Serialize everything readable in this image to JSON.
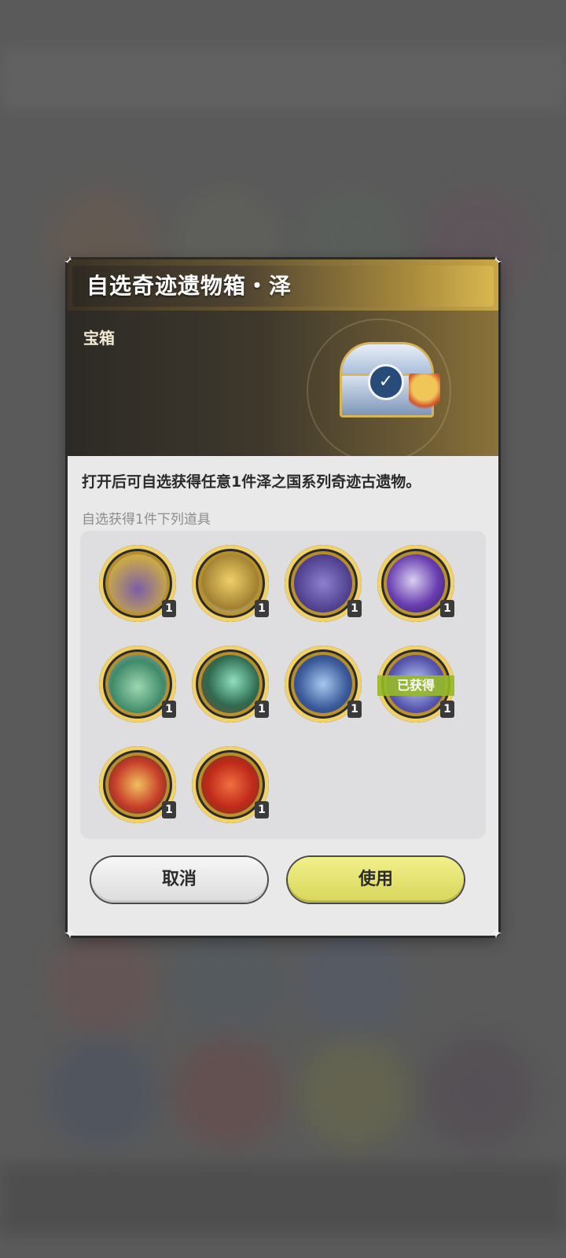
{
  "dialog": {
    "title": "自选奇迹遗物箱・泽",
    "category": "宝箱",
    "description": "打开后可自选获得任意1件泽之国系列奇迹古遗物。",
    "section_label": "自选获得1件下列道具",
    "items": [
      {
        "icon": "purple-chest-relic-icon",
        "qty": "1"
      },
      {
        "icon": "golden-lantern-relic-icon",
        "qty": "1"
      },
      {
        "icon": "purple-armor-relic-icon",
        "qty": "1"
      },
      {
        "icon": "purple-blade-relic-icon",
        "qty": "1"
      },
      {
        "icon": "green-pouch-relic-icon",
        "qty": "1"
      },
      {
        "icon": "green-cannon-relic-icon",
        "qty": "1"
      },
      {
        "icon": "blue-fish-relic-icon",
        "qty": "1"
      },
      {
        "icon": "blue-spirit-relic-icon",
        "qty": "1",
        "badge": "已获得"
      },
      {
        "icon": "red-trident-relic-icon",
        "qty": "1"
      },
      {
        "icon": "red-flame-relic-icon",
        "qty": "1"
      }
    ],
    "cancel_label": "取消",
    "use_label": "使用"
  },
  "colors": {
    "title_gold": "#c9a646",
    "use_button": "#e3e26d",
    "obtained_badge": "#96b928"
  }
}
